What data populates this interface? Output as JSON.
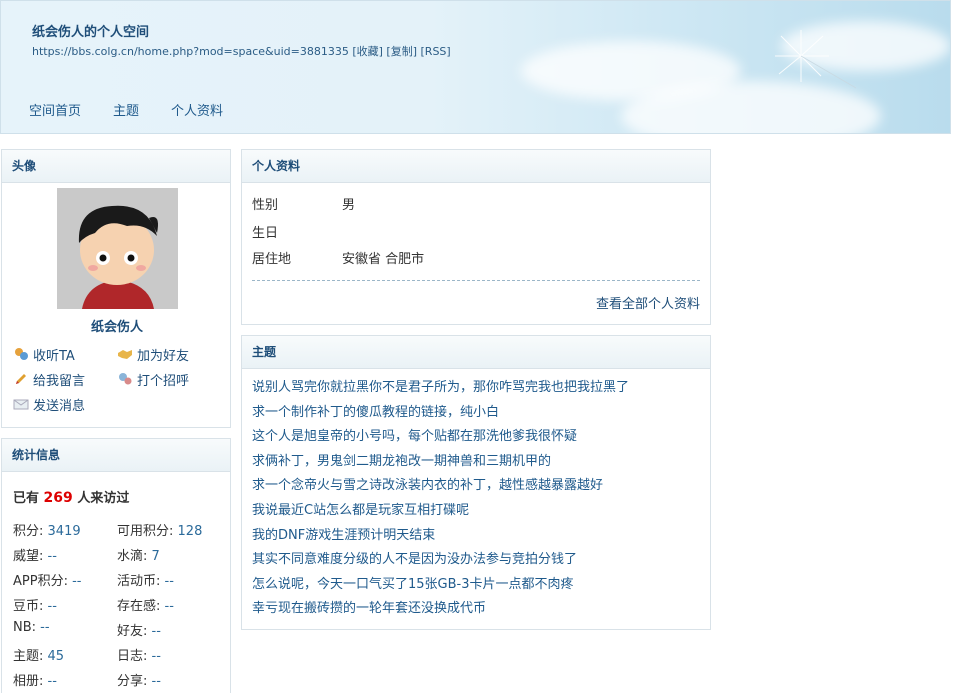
{
  "header": {
    "title": "纸会伤人的个人空间",
    "url": "https://bbs.colg.cn/home.php?mod=space&uid=3881335",
    "links": [
      "[收藏]",
      "[复制]",
      "[RSS]"
    ],
    "nav": [
      "空间首页",
      "主题",
      "个人资料"
    ]
  },
  "avatar_box": {
    "title": "头像",
    "username": "纸会伤人",
    "actions": [
      {
        "icon": "follow-icon",
        "label": "收听TA"
      },
      {
        "icon": "handshake-icon",
        "label": "加为好友"
      },
      {
        "icon": "pencil-icon",
        "label": "给我留言"
      },
      {
        "icon": "greet-icon",
        "label": "打个招呼"
      },
      {
        "icon": "envelope-icon",
        "label": "发送消息"
      }
    ]
  },
  "stats_box": {
    "title": "统计信息",
    "visit_prefix": "已有",
    "visit_count": "269",
    "visit_suffix": "人来访过",
    "items": [
      {
        "label": "积分:",
        "value": "3419"
      },
      {
        "label": "可用积分:",
        "value": "128"
      },
      {
        "label": "威望:",
        "value": "--"
      },
      {
        "label": "水滴:",
        "value": "7"
      },
      {
        "label": "APP积分:",
        "value": "--"
      },
      {
        "label": "活动币:",
        "value": "--"
      },
      {
        "label": "豆币:",
        "value": "--"
      },
      {
        "label": "存在感:",
        "value": "--"
      },
      {
        "label": "NB:",
        "value": "--"
      },
      {
        "label": "好友:",
        "value": "--"
      },
      {
        "label": "主题:",
        "value": "45"
      },
      {
        "label": "日志:",
        "value": "--"
      },
      {
        "label": "相册:",
        "value": "--"
      },
      {
        "label": "分享:",
        "value": "--"
      }
    ]
  },
  "profile_box": {
    "title": "个人资料",
    "rows": [
      {
        "label": "性别",
        "value": "男"
      },
      {
        "label": "生日",
        "value": ""
      },
      {
        "label": "居住地",
        "value": "安徽省 合肥市"
      }
    ],
    "more": "查看全部个人资料"
  },
  "topics_box": {
    "title": "主题",
    "items": [
      "说别人骂完你就拉黑你不是君子所为，那你咋骂完我也把我拉黑了",
      "求一个制作补丁的傻瓜教程的链接，纯小白",
      "这个人是旭皇帝的小号吗，每个贴都在那洗他爹我很怀疑",
      "求俩补丁，男鬼剑二期龙袍改一期神兽和三期机甲的",
      "求一个念帝火与雪之诗改泳装内衣的补丁，越性感越暴露越好",
      "我说最近C站怎么都是玩家互相打碟呢",
      "我的DNF游戏生涯预计明天结束",
      "其实不同意难度分级的人不是因为没办法参与竞拍分钱了",
      "怎么说呢，今天一口气买了15张GB-3卡片一点都不肉疼",
      "幸亏现在搬砖攒的一轮年套还没换成代币"
    ]
  }
}
